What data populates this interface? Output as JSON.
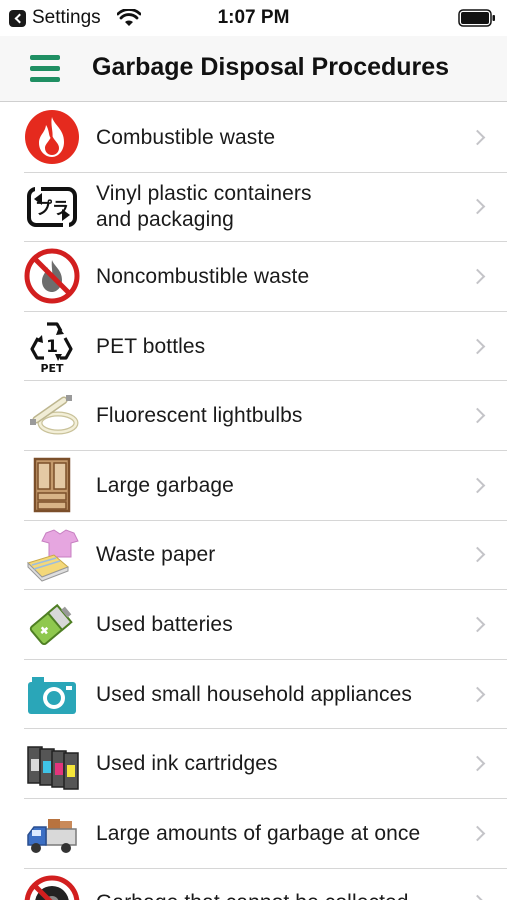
{
  "status_bar": {
    "back_app": "Settings",
    "time": "1:07 PM"
  },
  "nav": {
    "title": "Garbage Disposal Procedures",
    "menu_icon": "hamburger-icon",
    "accent_color": "#1f8f63"
  },
  "items": [
    {
      "label": "Combustible waste",
      "icon": "flame-icon"
    },
    {
      "label": "Vinyl plastic containers\nand packaging",
      "icon": "plastic-recycle-icon"
    },
    {
      "label": "Noncombustible waste",
      "icon": "no-fire-icon"
    },
    {
      "label": "PET bottles",
      "icon": "pet-recycle-icon",
      "icon_text": "PET",
      "icon_number": "1"
    },
    {
      "label": "Fluorescent lightbulbs",
      "icon": "fluorescent-bulb-icon"
    },
    {
      "label": "Large garbage",
      "icon": "cabinet-icon"
    },
    {
      "label": "Waste paper",
      "icon": "paper-clothes-icon"
    },
    {
      "label": "Used batteries",
      "icon": "battery-icon"
    },
    {
      "label": "Used small household appliances",
      "icon": "camera-icon"
    },
    {
      "label": "Used ink cartridges",
      "icon": "ink-cartridge-icon"
    },
    {
      "label": "Large amounts of garbage at once",
      "icon": "truck-icon"
    },
    {
      "label": "Garbage that cannot be collected",
      "icon": "tire-icon"
    }
  ]
}
